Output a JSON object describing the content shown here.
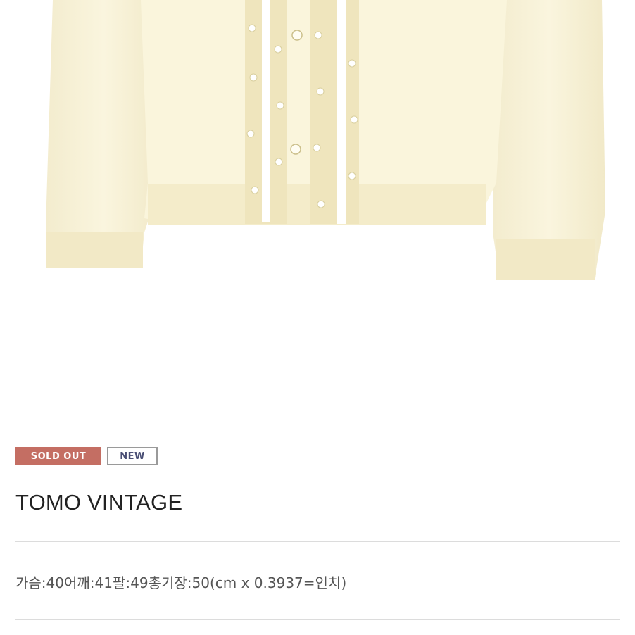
{
  "product": {
    "image_alt": "Cream beaded cardigan",
    "colors": {
      "garment": "#f8f2d6",
      "shade": "#ece3bd",
      "pearl": "#ffffff"
    }
  },
  "badges": {
    "sold_out": "SOLD OUT",
    "new": "NEW",
    "colors": {
      "sold_out_bg": "#c46e63",
      "new_text": "#4a4f75"
    }
  },
  "title": "TOMO VINTAGE",
  "spec": "가슴:40어깨:41팔:49총기장:50(cm x 0.3937=인치)"
}
